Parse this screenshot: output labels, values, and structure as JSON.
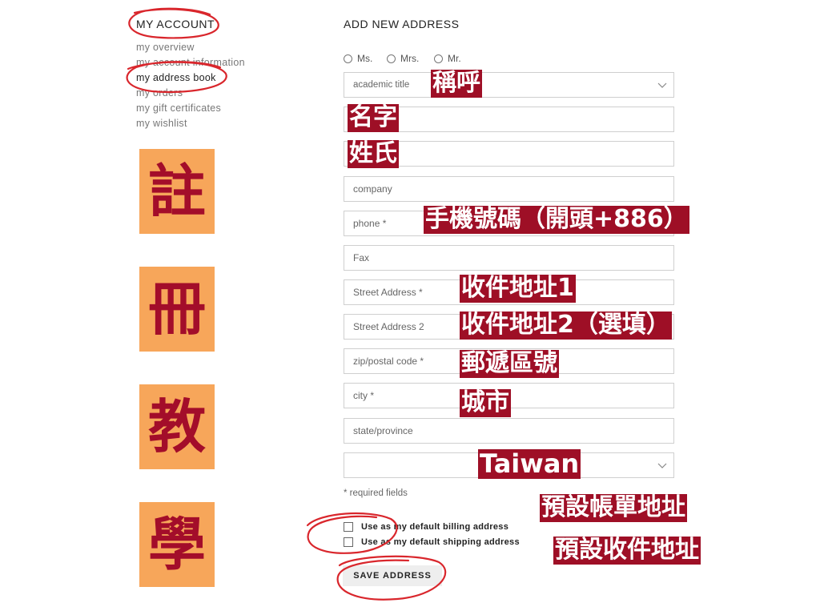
{
  "sidebar": {
    "title": "MY ACCOUNT",
    "items": [
      {
        "label": "my overview"
      },
      {
        "label": "my account information"
      },
      {
        "label": "my address book"
      },
      {
        "label": "my orders"
      },
      {
        "label": "my gift certificates"
      },
      {
        "label": "my wishlist"
      }
    ],
    "active_index": 2
  },
  "tiles": [
    "註",
    "冊",
    "教",
    "學"
  ],
  "form": {
    "title": "ADD NEW ADDRESS",
    "salutations": [
      "Ms.",
      "Mrs.",
      "Mr."
    ],
    "fields": {
      "academic_title": "academic title",
      "first_name": "",
      "last_name": "",
      "company": "company",
      "phone": "phone *",
      "fax": "Fax",
      "street1": "Street Address *",
      "street2": "Street Address 2",
      "zip": "zip/postal code *",
      "city": "city *",
      "state": "state/province",
      "country": ""
    },
    "required_note": "* required fields",
    "checkbox_billing": "Use as my default billing address",
    "checkbox_shipping": "Use as my default shipping address",
    "save_label": "SAVE ADDRESS"
  },
  "annotations": {
    "salutation": "稱呼",
    "first_name": "名字",
    "last_name": "姓氏",
    "phone": "手機號碼（開頭+886）",
    "street1": "收件地址1",
    "street2": "收件地址2（選填）",
    "zip": "郵遞區號",
    "city": "城市",
    "country": "Taiwan",
    "billing": "預設帳單地址",
    "shipping": "預設收件地址"
  },
  "colors": {
    "annotation_bg": "#9e0f26",
    "tile_bg": "#f7a65a",
    "tile_text": "#a30d2a",
    "circle_marks": "#d9262c"
  }
}
